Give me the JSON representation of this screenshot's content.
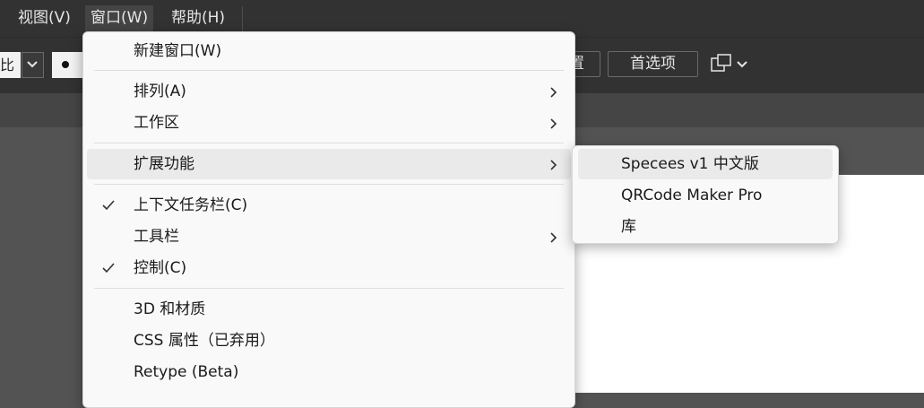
{
  "menubar": {
    "items": [
      {
        "label": "视图(V)"
      },
      {
        "label": "窗口(W)"
      },
      {
        "label": "帮助(H)"
      }
    ]
  },
  "controlbar": {
    "ratio_text": "比",
    "partial_button": "置",
    "prefs_button": "首选项"
  },
  "window_menu": {
    "items": [
      {
        "label": "新建窗口(W)"
      },
      {
        "label": "排列(A)"
      },
      {
        "label": "工作区"
      },
      {
        "label": "扩展功能"
      },
      {
        "label": "上下文任务栏(C)"
      },
      {
        "label": "工具栏"
      },
      {
        "label": "控制(C)"
      },
      {
        "label": "3D 和材质"
      },
      {
        "label": "CSS 属性（已弃用）"
      },
      {
        "label": "Retype (Beta)"
      }
    ]
  },
  "extensions_submenu": {
    "items": [
      {
        "label": "Specees v1 中文版"
      },
      {
        "label": "QRCode Maker Pro"
      },
      {
        "label": "库"
      }
    ]
  },
  "icons": [
    "chevron-down-icon",
    "checkmark-icon",
    "chevron-right-icon",
    "arrange-documents-icon"
  ]
}
